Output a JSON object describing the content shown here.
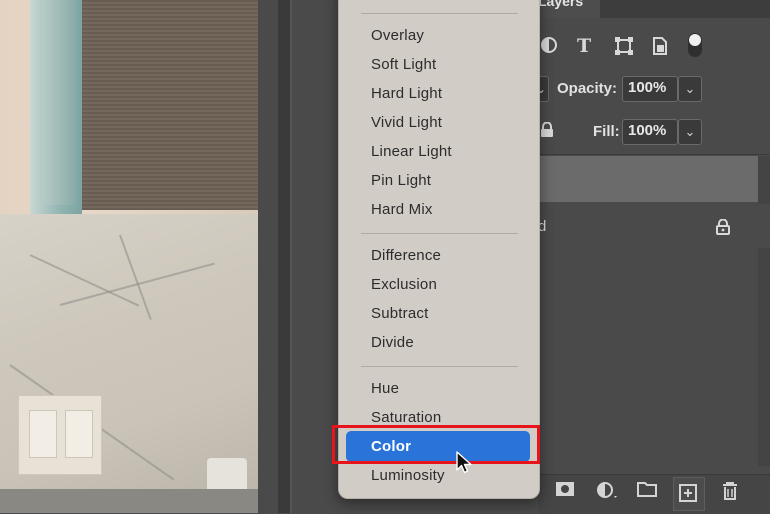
{
  "panel": {
    "tab_label": "Layers",
    "opacity_label": "Opacity:",
    "opacity_value": "100%",
    "fill_label": "Fill:",
    "fill_value": "100%",
    "layer_name_fragment": "d"
  },
  "blend_menu": {
    "groups": [
      [
        "Overlay",
        "Soft Light",
        "Hard Light",
        "Vivid Light",
        "Linear Light",
        "Pin Light",
        "Hard Mix"
      ],
      [
        "Difference",
        "Exclusion",
        "Subtract",
        "Divide"
      ],
      [
        "Hue",
        "Saturation",
        "Color",
        "Luminosity"
      ]
    ],
    "items": {
      "overlay": "Overlay",
      "soft_light": "Soft Light",
      "hard_light": "Hard Light",
      "vivid_light": "Vivid Light",
      "linear_light": "Linear Light",
      "pin_light": "Pin Light",
      "hard_mix": "Hard Mix",
      "difference": "Difference",
      "exclusion": "Exclusion",
      "subtract": "Subtract",
      "divide": "Divide",
      "hue": "Hue",
      "saturation": "Saturation",
      "color": "Color",
      "luminosity": "Luminosity"
    },
    "selected": "Color"
  },
  "colors": {
    "highlight": "#2a74d9",
    "callout": "#e8141c",
    "menu_bg": "#d2ccc7",
    "panel_bg": "#4a4a4a"
  },
  "icons": {
    "toolbar": [
      "adjustment-filter-icon",
      "type-filter-icon",
      "shape-filter-icon",
      "smart-object-filter-icon",
      "filter-toggle"
    ],
    "bottom": [
      "layer-mask-icon",
      "adjustment-layer-icon",
      "group-folder-icon",
      "new-layer-icon",
      "trash-icon"
    ],
    "lock": [
      "lock-icon",
      "layer-lock-icon"
    ]
  }
}
